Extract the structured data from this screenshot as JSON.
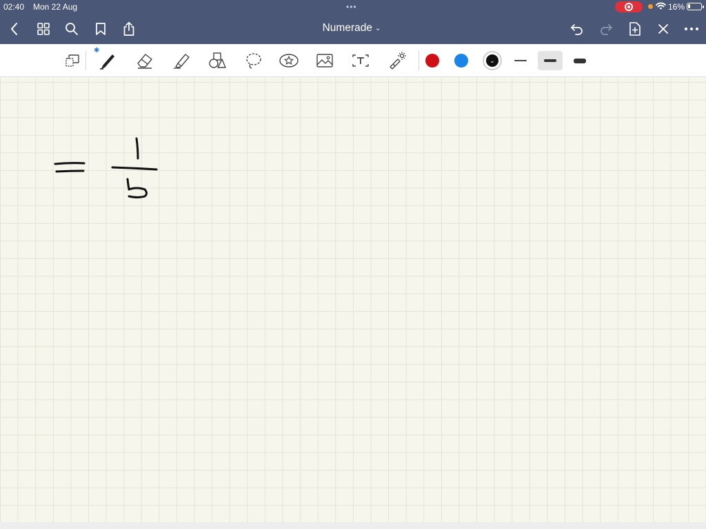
{
  "status": {
    "time": "02:40",
    "date": "Mon 22 Aug",
    "multitask": "•••",
    "battery": "16%"
  },
  "nav": {
    "title": "Numerade",
    "title_chevron": "⌄"
  },
  "toolbar": {
    "tools": [
      "select-tool-icon",
      "pen-icon",
      "eraser-icon",
      "highlighter-icon",
      "shapes-icon",
      "lasso-icon",
      "sticker-icon",
      "image-icon",
      "text-icon",
      "laser-pointer-icon"
    ],
    "bluetooth_mark": "✱",
    "colors": {
      "red": "#d00f17",
      "blue": "#1a84e8",
      "black": "#111111"
    },
    "selected_color_chevron": "⌄",
    "selected_stroke": "medium"
  },
  "colors": {
    "nav_bar": "#4a5776",
    "canvas": "#f6f6ec",
    "grid": "#e3e3d8",
    "recording": "#e0303a"
  }
}
